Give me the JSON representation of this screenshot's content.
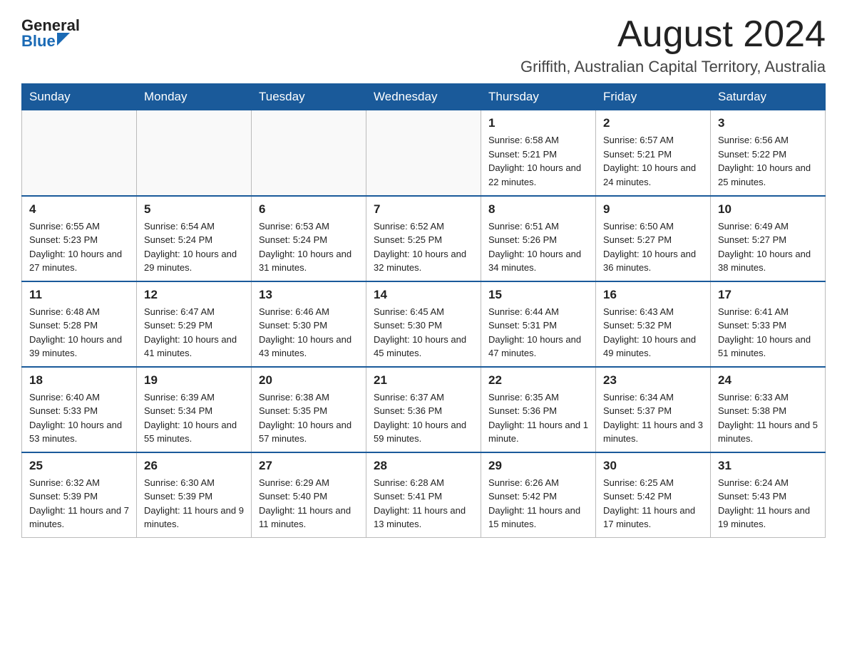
{
  "header": {
    "logo_general": "General",
    "logo_blue": "Blue",
    "month": "August 2024",
    "location": "Griffith, Australian Capital Territory, Australia"
  },
  "days_of_week": [
    "Sunday",
    "Monday",
    "Tuesday",
    "Wednesday",
    "Thursday",
    "Friday",
    "Saturday"
  ],
  "weeks": [
    [
      {
        "day": "",
        "info": ""
      },
      {
        "day": "",
        "info": ""
      },
      {
        "day": "",
        "info": ""
      },
      {
        "day": "",
        "info": ""
      },
      {
        "day": "1",
        "info": "Sunrise: 6:58 AM\nSunset: 5:21 PM\nDaylight: 10 hours and 22 minutes."
      },
      {
        "day": "2",
        "info": "Sunrise: 6:57 AM\nSunset: 5:21 PM\nDaylight: 10 hours and 24 minutes."
      },
      {
        "day": "3",
        "info": "Sunrise: 6:56 AM\nSunset: 5:22 PM\nDaylight: 10 hours and 25 minutes."
      }
    ],
    [
      {
        "day": "4",
        "info": "Sunrise: 6:55 AM\nSunset: 5:23 PM\nDaylight: 10 hours and 27 minutes."
      },
      {
        "day": "5",
        "info": "Sunrise: 6:54 AM\nSunset: 5:24 PM\nDaylight: 10 hours and 29 minutes."
      },
      {
        "day": "6",
        "info": "Sunrise: 6:53 AM\nSunset: 5:24 PM\nDaylight: 10 hours and 31 minutes."
      },
      {
        "day": "7",
        "info": "Sunrise: 6:52 AM\nSunset: 5:25 PM\nDaylight: 10 hours and 32 minutes."
      },
      {
        "day": "8",
        "info": "Sunrise: 6:51 AM\nSunset: 5:26 PM\nDaylight: 10 hours and 34 minutes."
      },
      {
        "day": "9",
        "info": "Sunrise: 6:50 AM\nSunset: 5:27 PM\nDaylight: 10 hours and 36 minutes."
      },
      {
        "day": "10",
        "info": "Sunrise: 6:49 AM\nSunset: 5:27 PM\nDaylight: 10 hours and 38 minutes."
      }
    ],
    [
      {
        "day": "11",
        "info": "Sunrise: 6:48 AM\nSunset: 5:28 PM\nDaylight: 10 hours and 39 minutes."
      },
      {
        "day": "12",
        "info": "Sunrise: 6:47 AM\nSunset: 5:29 PM\nDaylight: 10 hours and 41 minutes."
      },
      {
        "day": "13",
        "info": "Sunrise: 6:46 AM\nSunset: 5:30 PM\nDaylight: 10 hours and 43 minutes."
      },
      {
        "day": "14",
        "info": "Sunrise: 6:45 AM\nSunset: 5:30 PM\nDaylight: 10 hours and 45 minutes."
      },
      {
        "day": "15",
        "info": "Sunrise: 6:44 AM\nSunset: 5:31 PM\nDaylight: 10 hours and 47 minutes."
      },
      {
        "day": "16",
        "info": "Sunrise: 6:43 AM\nSunset: 5:32 PM\nDaylight: 10 hours and 49 minutes."
      },
      {
        "day": "17",
        "info": "Sunrise: 6:41 AM\nSunset: 5:33 PM\nDaylight: 10 hours and 51 minutes."
      }
    ],
    [
      {
        "day": "18",
        "info": "Sunrise: 6:40 AM\nSunset: 5:33 PM\nDaylight: 10 hours and 53 minutes."
      },
      {
        "day": "19",
        "info": "Sunrise: 6:39 AM\nSunset: 5:34 PM\nDaylight: 10 hours and 55 minutes."
      },
      {
        "day": "20",
        "info": "Sunrise: 6:38 AM\nSunset: 5:35 PM\nDaylight: 10 hours and 57 minutes."
      },
      {
        "day": "21",
        "info": "Sunrise: 6:37 AM\nSunset: 5:36 PM\nDaylight: 10 hours and 59 minutes."
      },
      {
        "day": "22",
        "info": "Sunrise: 6:35 AM\nSunset: 5:36 PM\nDaylight: 11 hours and 1 minute."
      },
      {
        "day": "23",
        "info": "Sunrise: 6:34 AM\nSunset: 5:37 PM\nDaylight: 11 hours and 3 minutes."
      },
      {
        "day": "24",
        "info": "Sunrise: 6:33 AM\nSunset: 5:38 PM\nDaylight: 11 hours and 5 minutes."
      }
    ],
    [
      {
        "day": "25",
        "info": "Sunrise: 6:32 AM\nSunset: 5:39 PM\nDaylight: 11 hours and 7 minutes."
      },
      {
        "day": "26",
        "info": "Sunrise: 6:30 AM\nSunset: 5:39 PM\nDaylight: 11 hours and 9 minutes."
      },
      {
        "day": "27",
        "info": "Sunrise: 6:29 AM\nSunset: 5:40 PM\nDaylight: 11 hours and 11 minutes."
      },
      {
        "day": "28",
        "info": "Sunrise: 6:28 AM\nSunset: 5:41 PM\nDaylight: 11 hours and 13 minutes."
      },
      {
        "day": "29",
        "info": "Sunrise: 6:26 AM\nSunset: 5:42 PM\nDaylight: 11 hours and 15 minutes."
      },
      {
        "day": "30",
        "info": "Sunrise: 6:25 AM\nSunset: 5:42 PM\nDaylight: 11 hours and 17 minutes."
      },
      {
        "day": "31",
        "info": "Sunrise: 6:24 AM\nSunset: 5:43 PM\nDaylight: 11 hours and 19 minutes."
      }
    ]
  ]
}
